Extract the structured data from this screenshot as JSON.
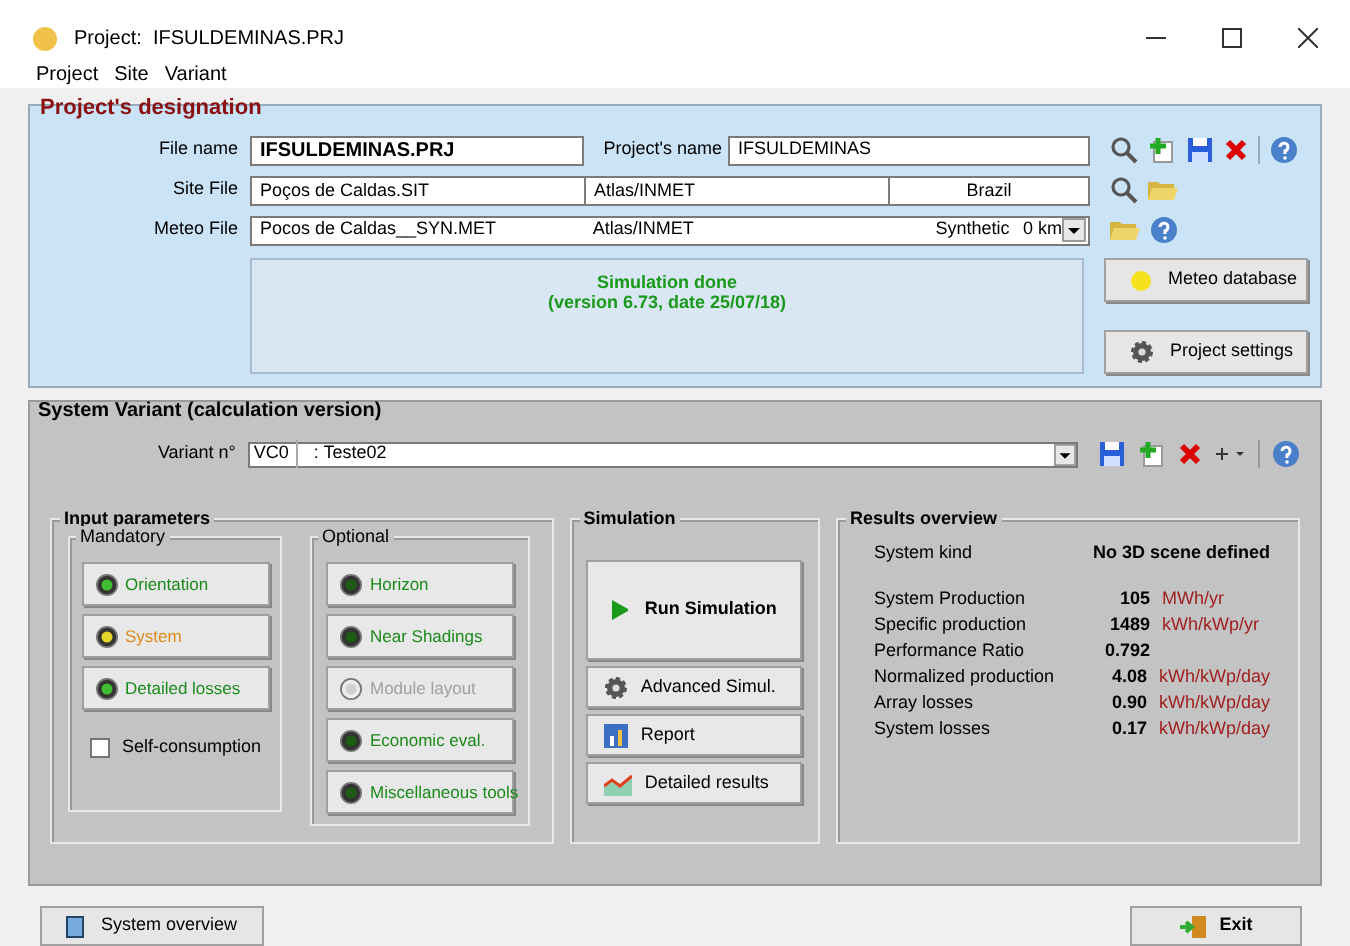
{
  "window": {
    "title": "Project:  IFSULDEMINAS.PRJ"
  },
  "menu": [
    "Project",
    "Site",
    "Variant"
  ],
  "project": {
    "title": "Project's designation",
    "file_name": {
      "label": "File name",
      "value": "IFSULDEMINAS.PRJ"
    },
    "project_name": {
      "label": "Project's name",
      "value": "IFSULDEMINAS"
    },
    "site_file": {
      "label": "Site File",
      "value": "Poços de Caldas.SIT",
      "source": "Atlas/INMET",
      "country": "Brazil"
    },
    "meteo_file": {
      "label": "Meteo File",
      "value": "Pocos de Caldas__SYN.MET",
      "source": "Atlas/INMET",
      "type": "Synthetic",
      "distance": "0 km"
    },
    "status": [
      "Simulation done",
      "(version 6.73, date 25/07/18)"
    ],
    "buttons": [
      "Meteo database",
      "Project settings"
    ]
  },
  "variant": {
    "title": "System Variant (calculation version)",
    "label": "Variant n°",
    "code": "VC0",
    "name": ": Teste02",
    "input_title": "Input parameters",
    "mandatory": {
      "title": "Mandatory",
      "items": [
        {
          "label": "Orientation",
          "color": "#3fbf2f",
          "disabled": false,
          "warning": false
        },
        {
          "label": "System",
          "color": "#e6d52a",
          "disabled": false,
          "warning": true
        },
        {
          "label": "Detailed losses",
          "color": "#3fbf2f",
          "disabled": false,
          "warning": false
        }
      ]
    },
    "self_consumption": {
      "label": "Self-consumption",
      "checked": false
    },
    "optional": {
      "title": "Optional",
      "items": [
        {
          "label": "Horizon",
          "color": "#1d5c14",
          "disabled": false
        },
        {
          "label": "Near Shadings",
          "color": "#1d5c14",
          "disabled": false
        },
        {
          "label": "Module layout",
          "color": "#d0d0d0",
          "disabled": true
        },
        {
          "label": "Economic eval.",
          "color": "#1d5c14",
          "disabled": false
        },
        {
          "label": "Miscellaneous tools",
          "color": "#1d5c14",
          "disabled": false
        }
      ]
    },
    "simulation": {
      "title": "Simulation",
      "run": "Run Simulation",
      "buttons": [
        {
          "kind": "gear",
          "label": "Advanced Simul."
        },
        {
          "kind": "report",
          "label": "Report"
        },
        {
          "kind": "chart",
          "label": "Detailed results"
        }
      ]
    },
    "results": {
      "title": "Results overview",
      "kind_label": "System kind",
      "kind_value": "No 3D scene defined",
      "rows": [
        {
          "label": "System Production",
          "value": "105",
          "unit": "MWh/yr"
        },
        {
          "label": "Specific production",
          "value": "1489",
          "unit": "kWh/kWp/yr"
        },
        {
          "label": "Performance Ratio",
          "value": "0.792"
        },
        {
          "label": "Normalized production",
          "value": "4.08",
          "unit": "kWh/kWp/day"
        },
        {
          "label": "Array losses",
          "value": "0.90",
          "unit": "kWh/kWp/day"
        },
        {
          "label": "System losses",
          "value": "0.17",
          "unit": "kWh/kWp/day"
        }
      ]
    }
  },
  "bottom": {
    "overview": "System overview",
    "exit": "Exit"
  }
}
